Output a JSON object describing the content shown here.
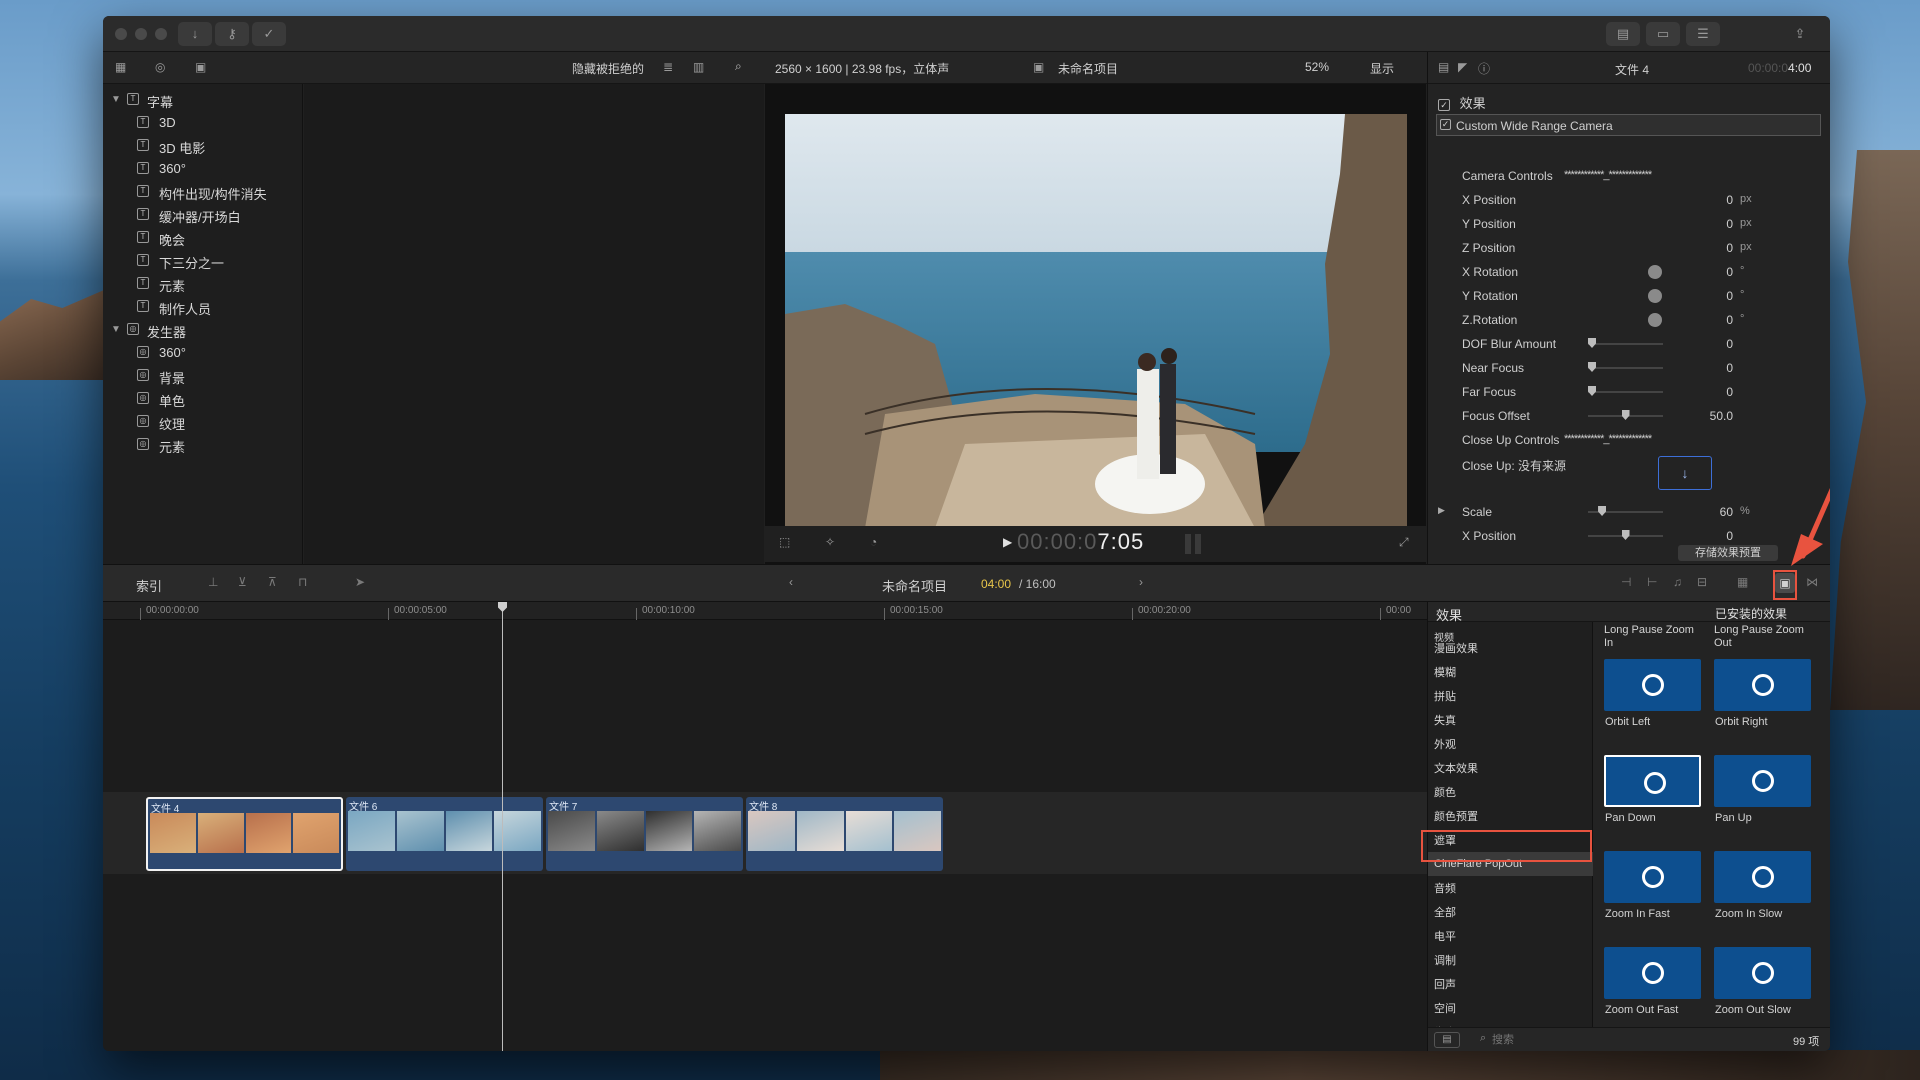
{
  "app": {
    "top_bar": {
      "hide_rejected": "隐藏被拒绝的",
      "format_info": "2560 × 1600 | 23.98 fps，立体声",
      "project_name": "未命名项目",
      "zoom": "52%",
      "display": "显示"
    },
    "library": {
      "groups": [
        {
          "name": "字幕",
          "items": [
            "3D",
            "3D 电影",
            "360°",
            "构件出现/构件消失",
            "缓冲器/开场白",
            "晚会",
            "下三分之一",
            "元素",
            "制作人员"
          ]
        },
        {
          "name": "发生器",
          "items": [
            "360°",
            "背景",
            "单色",
            "纹理",
            "元素"
          ]
        }
      ]
    },
    "viewer": {
      "timecode_dim": "00:00:0",
      "timecode_bright": "7:05"
    },
    "inspector": {
      "file_name": "文件 4",
      "duration_dim": "00:00:0",
      "duration_bright": "4:00",
      "effects_label": "效果",
      "effect_name": "Custom Wide Range Camera",
      "params": [
        {
          "name": "Camera Controls",
          "kind": "popup",
          "value": "************_*************"
        },
        {
          "name": "X Position",
          "kind": "value",
          "value": "0",
          "unit": "px"
        },
        {
          "name": "Y Position",
          "kind": "value",
          "value": "0",
          "unit": "px"
        },
        {
          "name": "Z Position",
          "kind": "value",
          "value": "0",
          "unit": "px"
        },
        {
          "name": "X Rotation",
          "kind": "dial",
          "value": "0",
          "unit": "°"
        },
        {
          "name": "Y Rotation",
          "kind": "dial",
          "value": "0",
          "unit": "°"
        },
        {
          "name": "Z.Rotation",
          "kind": "dial",
          "value": "0",
          "unit": "°"
        },
        {
          "name": "DOF Blur Amount",
          "kind": "slider",
          "value": "0",
          "level": 0.0
        },
        {
          "name": "Near Focus",
          "kind": "slider",
          "value": "0",
          "level": 0.0
        },
        {
          "name": "Far Focus",
          "kind": "slider",
          "value": "0",
          "level": 0.0
        },
        {
          "name": "Focus Offset",
          "kind": "slider",
          "value": "50.0",
          "level": 0.5
        },
        {
          "name": "Close Up Controls",
          "kind": "popup",
          "value": "************_*************"
        },
        {
          "name": "Close Up: 没有来源",
          "kind": "well",
          "value": ""
        },
        {
          "name": "Scale",
          "kind": "slider",
          "value": "60",
          "unit": "%",
          "level": 0.15
        },
        {
          "name": "X Position",
          "kind": "slider",
          "value": "0",
          "level": 0.5
        }
      ],
      "save_preset": "存储效果预置"
    },
    "timeline": {
      "index": "索引",
      "project_name": "未命名项目",
      "position": "04:00",
      "total": "/ 16:00",
      "ruler": [
        "00:00:00:00",
        "00:00:05:00",
        "00:00:10:00",
        "00:00:15:00",
        "00:00:20:00",
        "00:00"
      ],
      "clips": [
        {
          "name": "文件 4",
          "selected": true
        },
        {
          "name": "文件 6",
          "selected": false
        },
        {
          "name": "文件 7",
          "selected": false
        },
        {
          "name": "文件 8",
          "selected": false
        }
      ]
    },
    "effects_browser": {
      "title": "效果",
      "installed": "已安装的效果",
      "categories": [
        "视频",
        "漫画效果",
        "模糊",
        "拼贴",
        "失真",
        "外观",
        "文本效果",
        "颜色",
        "颜色预置",
        "遮罩",
        "CineFlare PopOut",
        "音频",
        "全部",
        "电平",
        "调制",
        "回声",
        "空间",
        "失真"
      ],
      "selected_category": "CineFlare PopOut",
      "top_labels": [
        "Long Pause Zoom In",
        "Long Pause Zoom Out"
      ],
      "items": [
        "Orbit Left",
        "Orbit Right",
        "Pan Down",
        "Pan Up",
        "Zoom In Fast",
        "Zoom In Slow",
        "Zoom Out Fast",
        "Zoom Out Slow"
      ],
      "highlighted": "Pan Down",
      "search_placeholder": "搜索",
      "count": "99 项"
    },
    "colors": {
      "accent_blue": "#0d4f8f",
      "timecode_yellow": "#e8c54a",
      "annotation_red": "#e8533f"
    }
  }
}
